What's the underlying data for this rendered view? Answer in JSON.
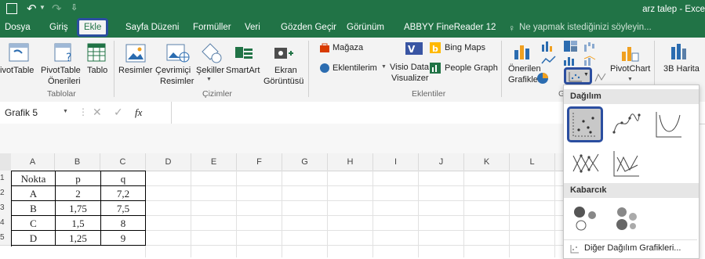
{
  "window": {
    "title": "arz talep - Exce"
  },
  "tabs": [
    "Dosya",
    "Giriş",
    "Ekle",
    "Sayfa Düzeni",
    "Formüller",
    "Veri",
    "Gözden Geçir",
    "Görünüm",
    "ABBYY FineReader 12"
  ],
  "active_tab": "Ekle",
  "tell_me": "Ne yapmak istediğinizi söyleyin...",
  "ribbon": {
    "pivot_table": "ivotTable",
    "recommended_pivot_1": "PivotTable",
    "recommended_pivot_2": "Önerileri",
    "table": "Tablo",
    "group_tables": "Tablolar",
    "pictures": "Resimler",
    "online_pictures_1": "Çevrimiçi",
    "online_pictures_2": "Resimler",
    "shapes": "Şekiller",
    "smartart": "SmartArt",
    "screenshot_1": "Ekran",
    "screenshot_2": "Görüntüsü",
    "group_illustrations": "Çizimler",
    "store": "Mağaza",
    "my_addins": "Eklentilerim",
    "visio_1": "Visio Data",
    "visio_2": "Visualizer",
    "bing_maps": "Bing Maps",
    "people_graph": "People Graph",
    "group_addins": "Eklentiler",
    "recommended_charts_1": "Önerilen",
    "recommended_charts_2": "Grafikler",
    "pivot_chart": "PivotChart",
    "map_3d": "3B Harita",
    "group_charts_fragment": "G"
  },
  "formula_bar": {
    "name_box": "Grafik 5",
    "fx": "fx"
  },
  "columns": [
    "A",
    "B",
    "C",
    "D",
    "E",
    "F",
    "G",
    "H",
    "I",
    "J",
    "K",
    "L"
  ],
  "rows": [
    "1",
    "2",
    "3",
    "4",
    "5"
  ],
  "table": [
    [
      "Nokta",
      "p",
      "q"
    ],
    [
      "A",
      "2",
      "7,2"
    ],
    [
      "B",
      "1,75",
      "7,5"
    ],
    [
      "C",
      "1,5",
      "8"
    ],
    [
      "D",
      "1,25",
      "9"
    ]
  ],
  "dropdown": {
    "scatter_header": "Dağılım",
    "bubble_header": "Kabarcık",
    "more_link": "Diğer Dağılım Grafikleri..."
  },
  "colors": {
    "excel_green": "#217346",
    "highlight_blue": "#2b4ea0"
  }
}
